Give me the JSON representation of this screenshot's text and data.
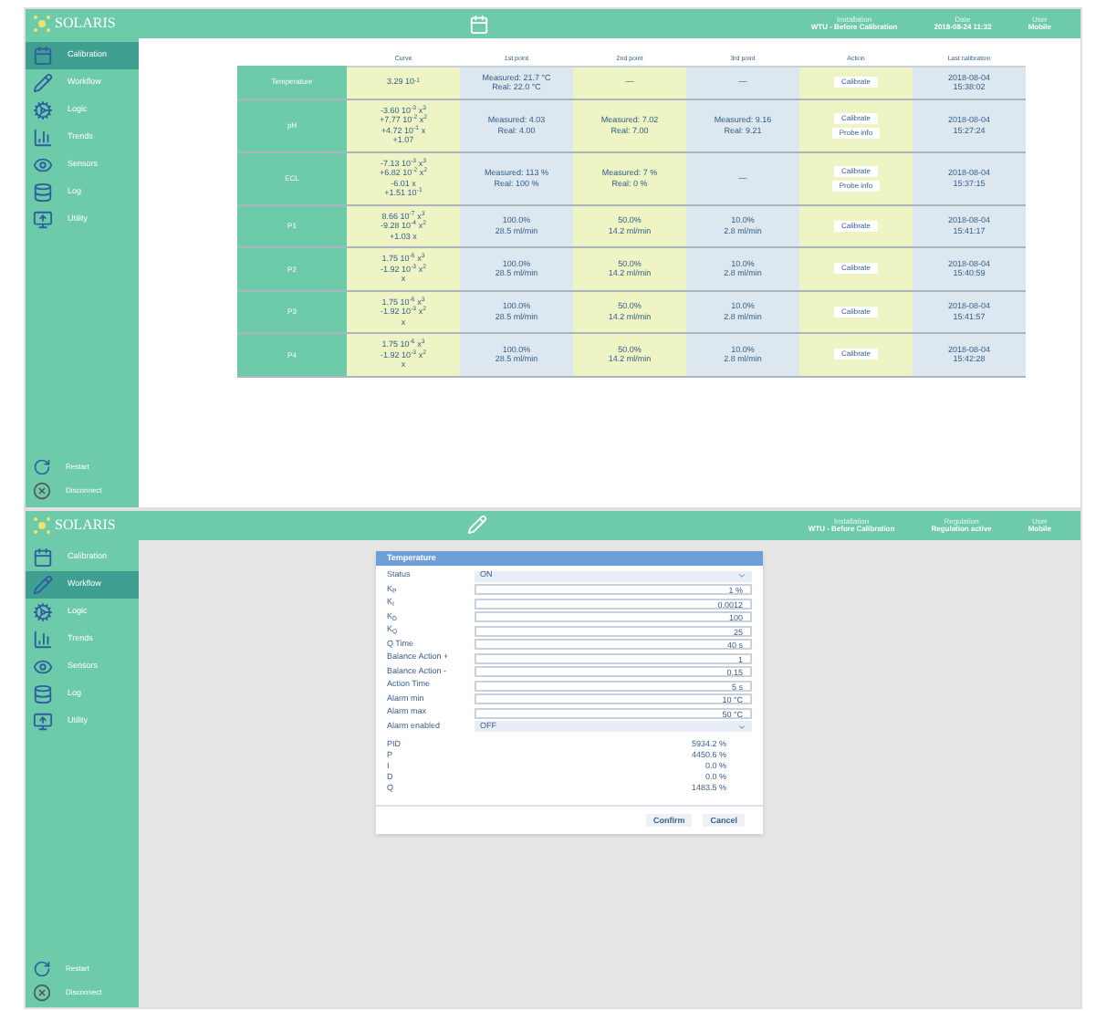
{
  "screens": [
    {
      "logo": "SOLARIS",
      "header_info": [
        {
          "label": "Installation",
          "value": "WTU - Before Calibration"
        },
        {
          "label": "Date",
          "value": "2018-08-24 11:32"
        },
        {
          "label": "User",
          "value": "Mobile"
        }
      ],
      "sidebar": [
        {
          "label": "Calibration",
          "selected": true
        },
        {
          "label": "Workflow",
          "selected": false
        },
        {
          "label": "Logic",
          "selected": false
        },
        {
          "label": "Trends",
          "selected": false
        },
        {
          "label": "Sensors",
          "selected": false
        },
        {
          "label": "Log",
          "selected": false
        },
        {
          "label": "Utility",
          "selected": false
        }
      ],
      "sidebar_bottom": [
        {
          "label": "Restart"
        },
        {
          "label": "Disconnect"
        }
      ],
      "table": {
        "columns": [
          "Curve",
          "1st point",
          "2nd point",
          "3rd point",
          "Action",
          "Last calibration"
        ],
        "rows": [
          {
            "name": "Temperature",
            "cells": [
              [
                "3.29 10$^{-1}$"
              ],
              [
                "Measured: 21.7 °C",
                "Real: 22.0 °C"
              ],
              [
                "—"
              ],
              [
                "—"
              ]
            ],
            "actions": [
              "Calibrate"
            ],
            "date": [
              "2018-08-04",
              "15:38:02"
            ]
          },
          {
            "name": "pH",
            "cells": [
              [
                "-3.60 10$^{-3}$ x$^{3}$",
                "+7.77 10$^{-2}$ x$^{2}$",
                "+4.72 10$^{-1}$ x",
                "+1.07"
              ],
              [
                "Measured: 4.03",
                "Real: 4.00"
              ],
              [
                "Measured: 7.02",
                "Real: 7.00"
              ],
              [
                "Measured: 9.16",
                "Real: 9.21"
              ]
            ],
            "actions": [
              "Calibrate",
              "Probe info"
            ],
            "date": [
              "2018-08-04",
              "15:27:24"
            ]
          },
          {
            "name": "ECL",
            "cells": [
              [
                "-7.13 10$^{-3}$ x$^{3}$",
                "+6.82 10$^{-2}$ x$^{2}$",
                "-6.01 x",
                "+1.51 10$^{-1}$"
              ],
              [
                "Measured: 113 %",
                "Real: 100 %"
              ],
              [
                "Measured: 7 %",
                "Real: 0 %"
              ],
              [
                "—"
              ]
            ],
            "actions": [
              "Calibrate",
              "Probe info"
            ],
            "date": [
              "2018-08-04",
              "15:37:15"
            ]
          },
          {
            "name": "P1",
            "cells": [
              [
                "8.66 10$^{-7}$ x$^{3}$",
                "-9.28 10$^{-4}$ x$^{2}$",
                "+1.03 x"
              ],
              [
                "100.0%",
                "28.5 ml/min"
              ],
              [
                "50.0%",
                "14.2 ml/min"
              ],
              [
                "10.0%",
                "2.8 ml/min"
              ]
            ],
            "actions": [
              "Calibrate"
            ],
            "date": [
              "2018-08-04",
              "15:41:17"
            ]
          },
          {
            "name": "P2",
            "cells": [
              [
                "1.75 10$^{-6}$ x$^{3}$",
                "-1.92 10$^{-3}$ x$^{2}$",
                "x"
              ],
              [
                "100.0%",
                "28.5 ml/min"
              ],
              [
                "50.0%",
                "14.2 ml/min"
              ],
              [
                "10.0%",
                "2.8 ml/min"
              ]
            ],
            "actions": [
              "Calibrate"
            ],
            "date": [
              "2018-08-04",
              "15:40:59"
            ]
          },
          {
            "name": "P3",
            "cells": [
              [
                "1.75 10$^{-6}$ x$^{3}$",
                "-1.92 10$^{-3}$ x$^{2}$",
                "x"
              ],
              [
                "100.0%",
                "28.5 ml/min"
              ],
              [
                "50.0%",
                "14.2 ml/min"
              ],
              [
                "10.0%",
                "2.8 ml/min"
              ]
            ],
            "actions": [
              "Calibrate"
            ],
            "date": [
              "2018-08-04",
              "15:41:57"
            ]
          },
          {
            "name": "P4",
            "cells": [
              [
                "1.75 10$^{-6}$ x$^{3}$",
                "-1.92 10$^{-3}$ x$^{2}$",
                "x"
              ],
              [
                "100.0%",
                "28.5 ml/min"
              ],
              [
                "50.0%",
                "14.2 ml/min"
              ],
              [
                "10.0%",
                "2.8 ml/min"
              ]
            ],
            "actions": [
              "Calibrate"
            ],
            "date": [
              "2018-08-04",
              "15:42:28"
            ]
          }
        ]
      }
    },
    {
      "logo": "SOLARIS",
      "header_info": [
        {
          "label": "Installation",
          "value": "WTU - Before Calibration"
        },
        {
          "label": "Regulation",
          "value": "Regulation active"
        },
        {
          "label": "User",
          "value": "Mobile"
        }
      ],
      "sidebar": [
        {
          "label": "Calibration",
          "selected": false
        },
        {
          "label": "Workflow",
          "selected": true
        },
        {
          "label": "Logic",
          "selected": false
        },
        {
          "label": "Trends",
          "selected": false
        },
        {
          "label": "Sensors",
          "selected": false
        },
        {
          "label": "Log",
          "selected": false
        },
        {
          "label": "Utility",
          "selected": false
        }
      ],
      "sidebar_bottom": [
        {
          "label": "Restart"
        },
        {
          "label": "Disconnect"
        }
      ],
      "dialog": {
        "title": "Temperature",
        "fields": [
          {
            "kind": "select",
            "label": "Status",
            "value": "ON"
          },
          {
            "kind": "input",
            "label": "K$_{P}$",
            "value": "1 %"
          },
          {
            "kind": "input",
            "label": "K$_{I}$",
            "value": "0.0012"
          },
          {
            "kind": "input",
            "label": "K$_{D}$",
            "value": "100"
          },
          {
            "kind": "input",
            "label": "K$_{Q}$",
            "value": "25"
          },
          {
            "kind": "input",
            "label": "Q Time",
            "value": "40 s"
          },
          {
            "kind": "input",
            "label": "Balance Action +",
            "value": "1"
          },
          {
            "kind": "input",
            "label": "Balance Action -",
            "value": "0.15"
          },
          {
            "kind": "input",
            "label": "Action Time",
            "value": "5 s"
          },
          {
            "kind": "input",
            "label": "Alarm min",
            "value": "10 °C"
          },
          {
            "kind": "input",
            "label": "Alarm max",
            "value": "50 °C"
          },
          {
            "kind": "select",
            "label": "Alarm enabled",
            "value": "OFF"
          }
        ],
        "readouts": [
          {
            "label": "PID",
            "value": "5934.2 %"
          },
          {
            "label": "P",
            "value": "4450.6 %"
          },
          {
            "label": "I",
            "value": "0.0 %"
          },
          {
            "label": "D",
            "value": "0.0 %"
          },
          {
            "label": "Q",
            "value": "1483.5 %"
          }
        ],
        "buttons": [
          "Confirm",
          "Cancel"
        ]
      }
    }
  ]
}
